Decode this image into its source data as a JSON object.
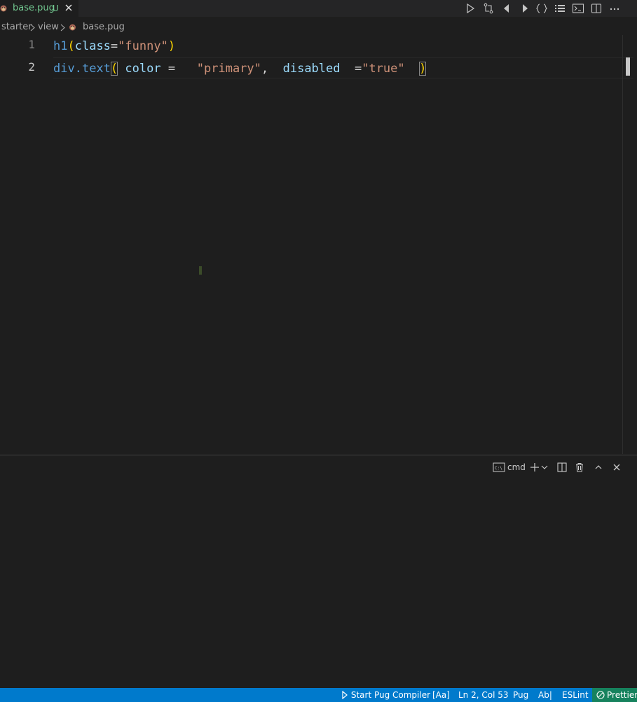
{
  "tab": {
    "filename": "base.pug",
    "status": "U"
  },
  "breadcrumb": {
    "items": [
      "starter",
      "view",
      "base.pug"
    ]
  },
  "editor": {
    "line_numbers": [
      "1",
      "2"
    ],
    "line1": {
      "tag": "h1",
      "paren_open": "(",
      "attr": "class",
      "eq": "=",
      "value": "\"funny\"",
      "paren_close": ")"
    },
    "line2": {
      "tag": "div",
      "cls": ".text",
      "paren_open": "(",
      "attr1": " color ",
      "eq1": "=   ",
      "value1": "\"primary\"",
      "comma": ",  ",
      "attr2": "disabled",
      "eq2": "  =",
      "value2": "\"true\"",
      "space": "  ",
      "paren_close": ")"
    }
  },
  "panel": {
    "terminal_name": "cmd"
  },
  "statusbar": {
    "start_compiler": "Start Pug Compiler",
    "case_toggle": "[Aa]",
    "position": "Ln 2, Col 53",
    "language": "Pug",
    "spell": "Ab|",
    "eslint": "ESLint",
    "prettier": "Prettier"
  },
  "colors": {
    "statusbar_bg": "#007acc",
    "prettier_bg": "#16825d",
    "untracked_file": "#73c991",
    "bracket": "#ffd700"
  },
  "icons": [
    "pug-file-icon",
    "close-icon",
    "run-icon",
    "compare-changes-icon",
    "previous-change-icon",
    "next-change-icon",
    "braces-icon",
    "list-icon",
    "terminal-icon",
    "split-editor-icon",
    "more-actions-icon",
    "chevron-right-icon",
    "plus-icon",
    "chevron-down-icon",
    "trash-icon",
    "chevron-up-icon",
    "play-icon",
    "check-circle-icon"
  ]
}
